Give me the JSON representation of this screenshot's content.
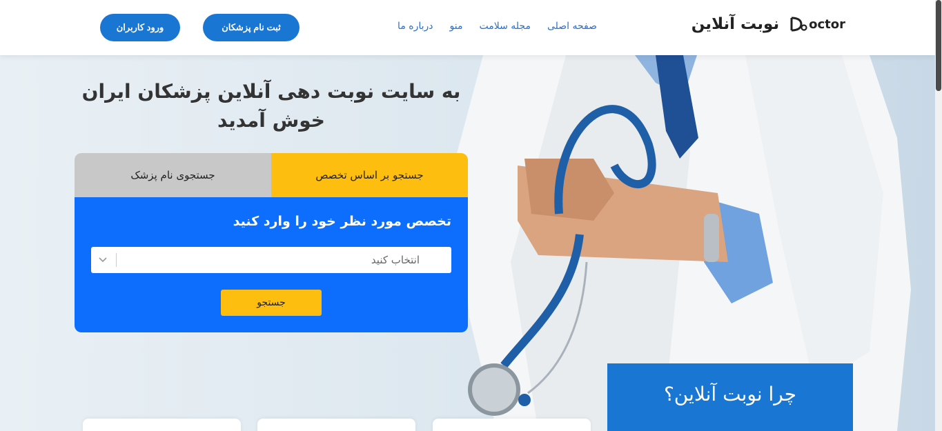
{
  "header": {
    "brand_title": "نوبت آنلاین",
    "brand_logo_text": "octor",
    "nav": [
      {
        "label": "صفحه اصلی"
      },
      {
        "label": "مجله سلامت"
      },
      {
        "label": "منو"
      },
      {
        "label": "درباره ما"
      }
    ],
    "register_doctor_label": "ثبت نام پزشکان",
    "login_label": "ورود کاربران"
  },
  "hero": {
    "welcome_line1": "به سایت نوبت دهی آنلاین پزشکان ایران",
    "welcome_line2": "خوش آمدید"
  },
  "search": {
    "tab_specialty": "جستجو بر اساس تخصص",
    "tab_doctor_name": "جستجوی نام پزشک",
    "active_tab": "tab_specialty",
    "panel_title": "تخصص مورد نظر خود را وارد کنید",
    "select_value": "انتخاب کنید",
    "search_button": "جستجو"
  },
  "why": {
    "title": "چرا نوبت آنلاین؟"
  },
  "colors": {
    "primary": "#1976d2",
    "panel_blue": "#0d6efd",
    "accent_yellow": "#fdbe10",
    "tab_gray": "#c8c8c8"
  },
  "icons": {
    "brand": "stethoscope-logo-icon",
    "select_arrow": "chevron-down-icon"
  }
}
